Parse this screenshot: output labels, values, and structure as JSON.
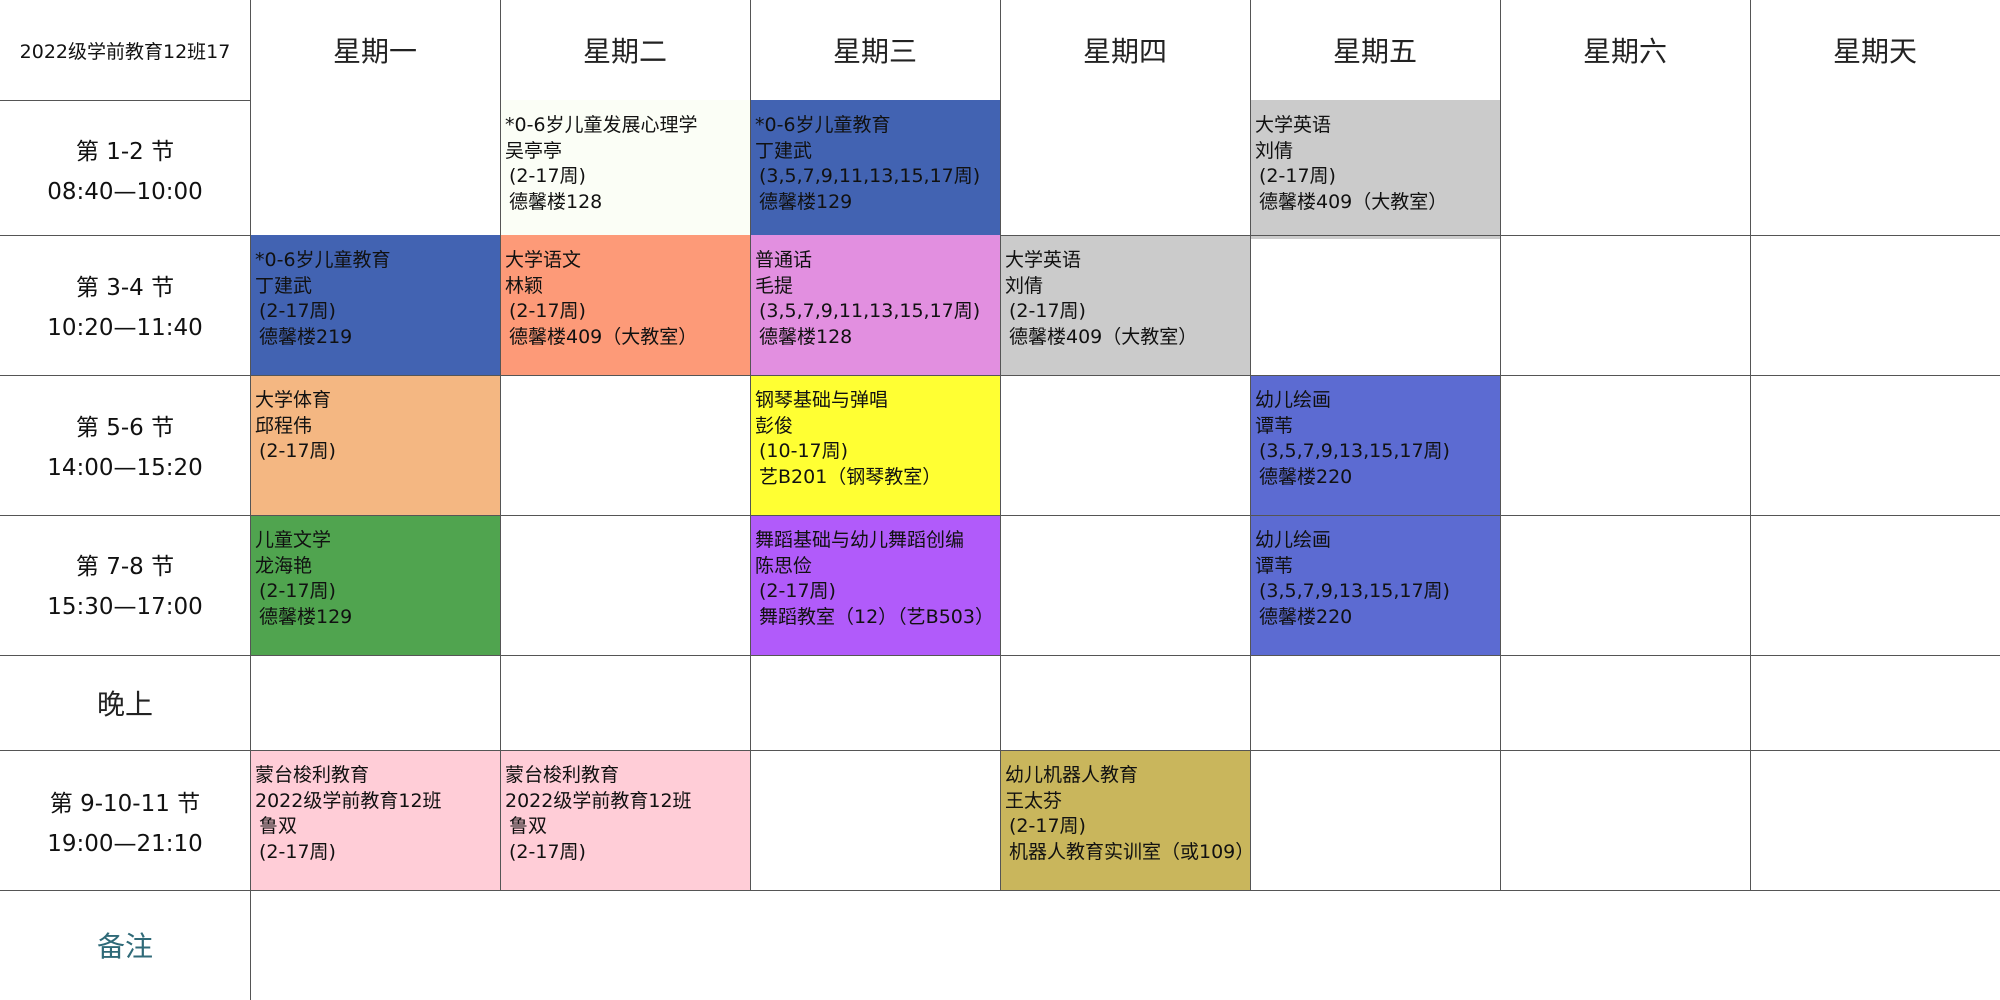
{
  "corner_title": "2022级学前教育12班17",
  "days": [
    "星期一",
    "星期二",
    "星期三",
    "星期四",
    "星期五",
    "星期六",
    "星期天"
  ],
  "periods": [
    {
      "label": "第 1-2 节",
      "time": "08:40—10:00"
    },
    {
      "label": "第 3-4 节",
      "time": "10:20—11:40"
    },
    {
      "label": "第 5-6 节",
      "time": "14:00—15:20"
    },
    {
      "label": "第 7-8 节",
      "time": "15:30—17:00"
    },
    {
      "label": "晚上",
      "time": ""
    },
    {
      "label": "第 9-10-11 节",
      "time": "19:00—21:10"
    },
    {
      "label": "备注",
      "time": ""
    }
  ],
  "courses": {
    "tue_p1": {
      "name": "*0-6岁儿童发展心理学",
      "teacher": "吴亭亭",
      "weeks": "(2-17周)",
      "room": "德馨楼128",
      "color": "#fbfef6"
    },
    "wed_p1": {
      "name": "*0-6岁儿童教育",
      "teacher": "丁建武",
      "weeks": "(3,5,7,9,11,13,15,17周)",
      "room": "德馨楼129",
      "color": "#4263b2"
    },
    "fri_p1": {
      "name": "大学英语",
      "teacher": "刘倩",
      "weeks": "(2-17周)",
      "room": "德馨楼409（大教室）",
      "color": "#cbcbcb"
    },
    "mon_p2": {
      "name": "*0-6岁儿童教育",
      "teacher": "丁建武",
      "weeks": "(2-17周)",
      "room": "德馨楼219",
      "color": "#4263b2"
    },
    "tue_p2": {
      "name": "大学语文",
      "teacher": "林颖",
      "weeks": "(2-17周)",
      "room": "德馨楼409（大教室）",
      "color": "#fd9a78"
    },
    "wed_p2": {
      "name": "普通话",
      "teacher": "毛提",
      "weeks": "(3,5,7,9,11,13,15,17周)",
      "room": "德馨楼128",
      "color": "#e28fe0"
    },
    "thu_p2": {
      "name": "大学英语",
      "teacher": "刘倩",
      "weeks": "(2-17周)",
      "room": "德馨楼409（大教室）",
      "color": "#cbcbcb"
    },
    "mon_p3": {
      "name": "大学体育",
      "teacher": "邱程伟",
      "weeks": "(2-17周)",
      "room": "",
      "color": "#f4b782"
    },
    "wed_p3": {
      "name": "钢琴基础与弹唱",
      "teacher": "彭俊",
      "weeks": "(10-17周)",
      "room": "艺B201（钢琴教室）",
      "color": "#ffff33"
    },
    "fri_p3": {
      "name": "幼儿绘画",
      "teacher": "谭苇",
      "weeks": "(3,5,7,9,13,15,17周)",
      "room": "德馨楼220",
      "color": "#5c6bd2"
    },
    "mon_p4": {
      "name": "儿童文学",
      "teacher": "龙海艳",
      "weeks": "(2-17周)",
      "room": "德馨楼129",
      "color": "#50a44f"
    },
    "wed_p4": {
      "name": "舞蹈基础与幼儿舞蹈创编",
      "teacher": "陈思俭",
      "weeks": "(2-17周)",
      "room": "舞蹈教室（12）（艺B503）",
      "color": "#b15bfa"
    },
    "fri_p4": {
      "name": "幼儿绘画",
      "teacher": "谭苇",
      "weeks": "(3,5,7,9,13,15,17周)",
      "room": "德馨楼220",
      "color": "#5c6bd2"
    },
    "mon_p6": {
      "name": "蒙台梭利教育",
      "teacher": "2022级学前教育12班",
      "weeks": "鲁双",
      "room": "(2-17周)",
      "color": "#ffcdd7"
    },
    "tue_p6": {
      "name": "蒙台梭利教育",
      "teacher": "2022级学前教育12班",
      "weeks": "鲁双",
      "room": "(2-17周)",
      "color": "#ffcdd7"
    },
    "thu_p6": {
      "name": "幼儿机器人教育",
      "teacher": "王太芬",
      "weeks": "(2-17周)",
      "room": "机器人教育实训室（或109）",
      "color": "#c9b65c"
    }
  }
}
